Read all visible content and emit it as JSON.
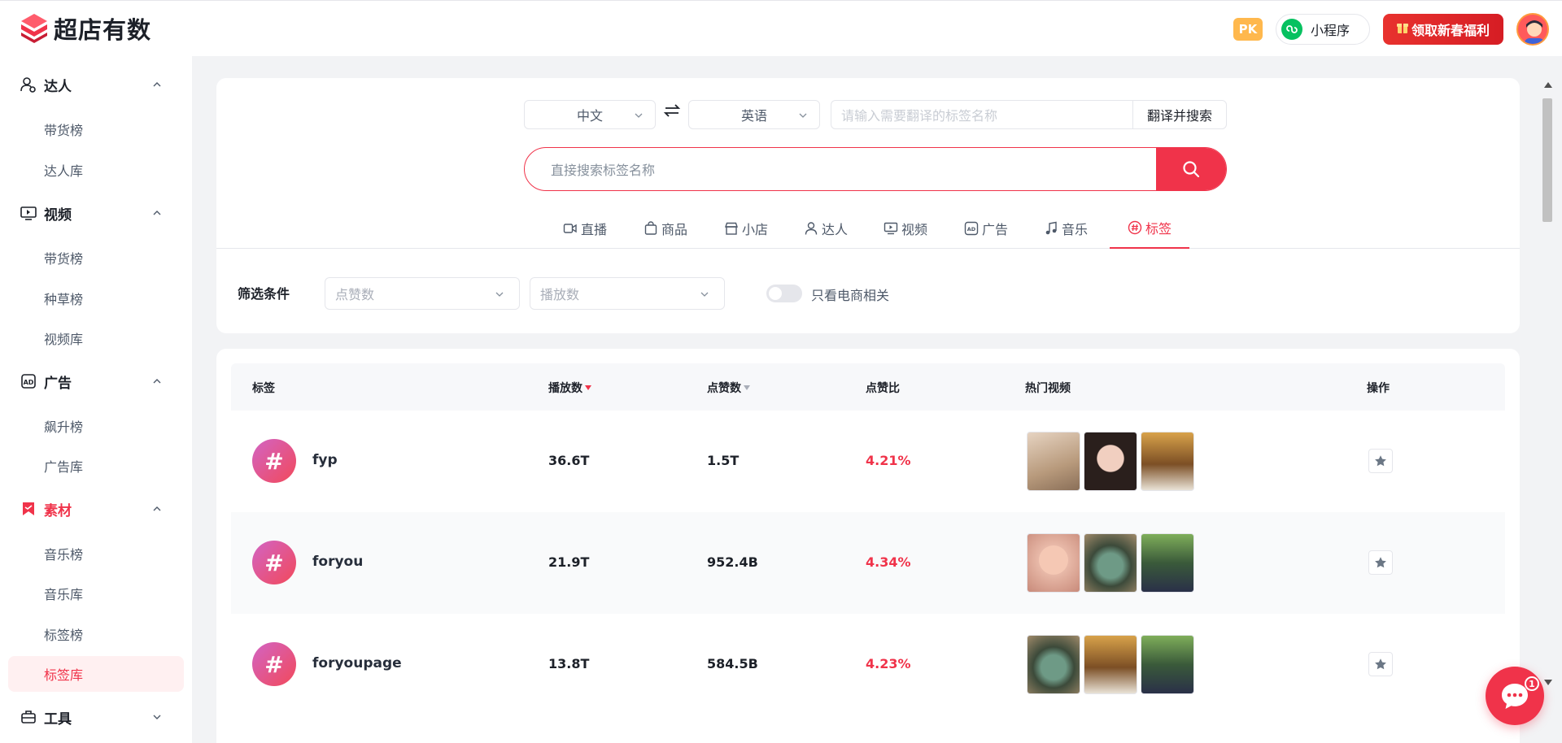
{
  "app": {
    "name": "超店有数",
    "brand_color": "#f0334a"
  },
  "header": {
    "pk_label": "PK",
    "mini_program_label": "小程序",
    "promo_label": "领取新春福利"
  },
  "sidebar": {
    "groups": [
      {
        "label": "达人",
        "icon": "user-icon",
        "items": [
          "带货榜",
          "达人库"
        ]
      },
      {
        "label": "视频",
        "icon": "video-icon",
        "items": [
          "带货榜",
          "种草榜",
          "视频库"
        ]
      },
      {
        "label": "广告",
        "icon": "ad-icon",
        "items": [
          "飙升榜",
          "广告库"
        ]
      },
      {
        "label": "素材",
        "icon": "bookmark-icon",
        "items": [
          "音乐榜",
          "音乐库",
          "标签榜",
          "标签库"
        ]
      },
      {
        "label": "工具",
        "icon": "toolbox-icon",
        "items": []
      }
    ],
    "active_group": "素材",
    "active_item": "标签库"
  },
  "translate": {
    "source_lang": "中文",
    "target_lang": "英语",
    "input_placeholder": "请输入需要翻译的标签名称",
    "button_label": "翻译并搜索"
  },
  "search": {
    "placeholder": "直接搜索标签名称"
  },
  "tabs": [
    {
      "label": "直播",
      "icon": "live-icon"
    },
    {
      "label": "商品",
      "icon": "bag-icon"
    },
    {
      "label": "小店",
      "icon": "shop-icon"
    },
    {
      "label": "达人",
      "icon": "person-icon"
    },
    {
      "label": "视频",
      "icon": "video-icon"
    },
    {
      "label": "广告",
      "icon": "ad-icon"
    },
    {
      "label": "音乐",
      "icon": "music-icon"
    },
    {
      "label": "标签",
      "icon": "hashtag-icon"
    }
  ],
  "active_tab": "标签",
  "filters": {
    "label": "筛选条件",
    "likes_placeholder": "点赞数",
    "plays_placeholder": "播放数",
    "ecommerce_only_label": "只看电商相关",
    "ecommerce_only": false
  },
  "table": {
    "columns": [
      "标签",
      "播放数",
      "点赞数",
      "点赞比",
      "热门视频",
      "操作"
    ],
    "sort": {
      "column": "播放数",
      "direction": "desc"
    },
    "rows": [
      {
        "tag": "fyp",
        "plays": "36.6T",
        "likes": "1.5T",
        "ratio": "4.21%"
      },
      {
        "tag": "foryou",
        "plays": "21.9T",
        "likes": "952.4B",
        "ratio": "4.34%"
      },
      {
        "tag": "foryoupage",
        "plays": "13.8T",
        "likes": "584.5B",
        "ratio": "4.23%"
      }
    ]
  },
  "chat": {
    "badge_count": "1"
  }
}
